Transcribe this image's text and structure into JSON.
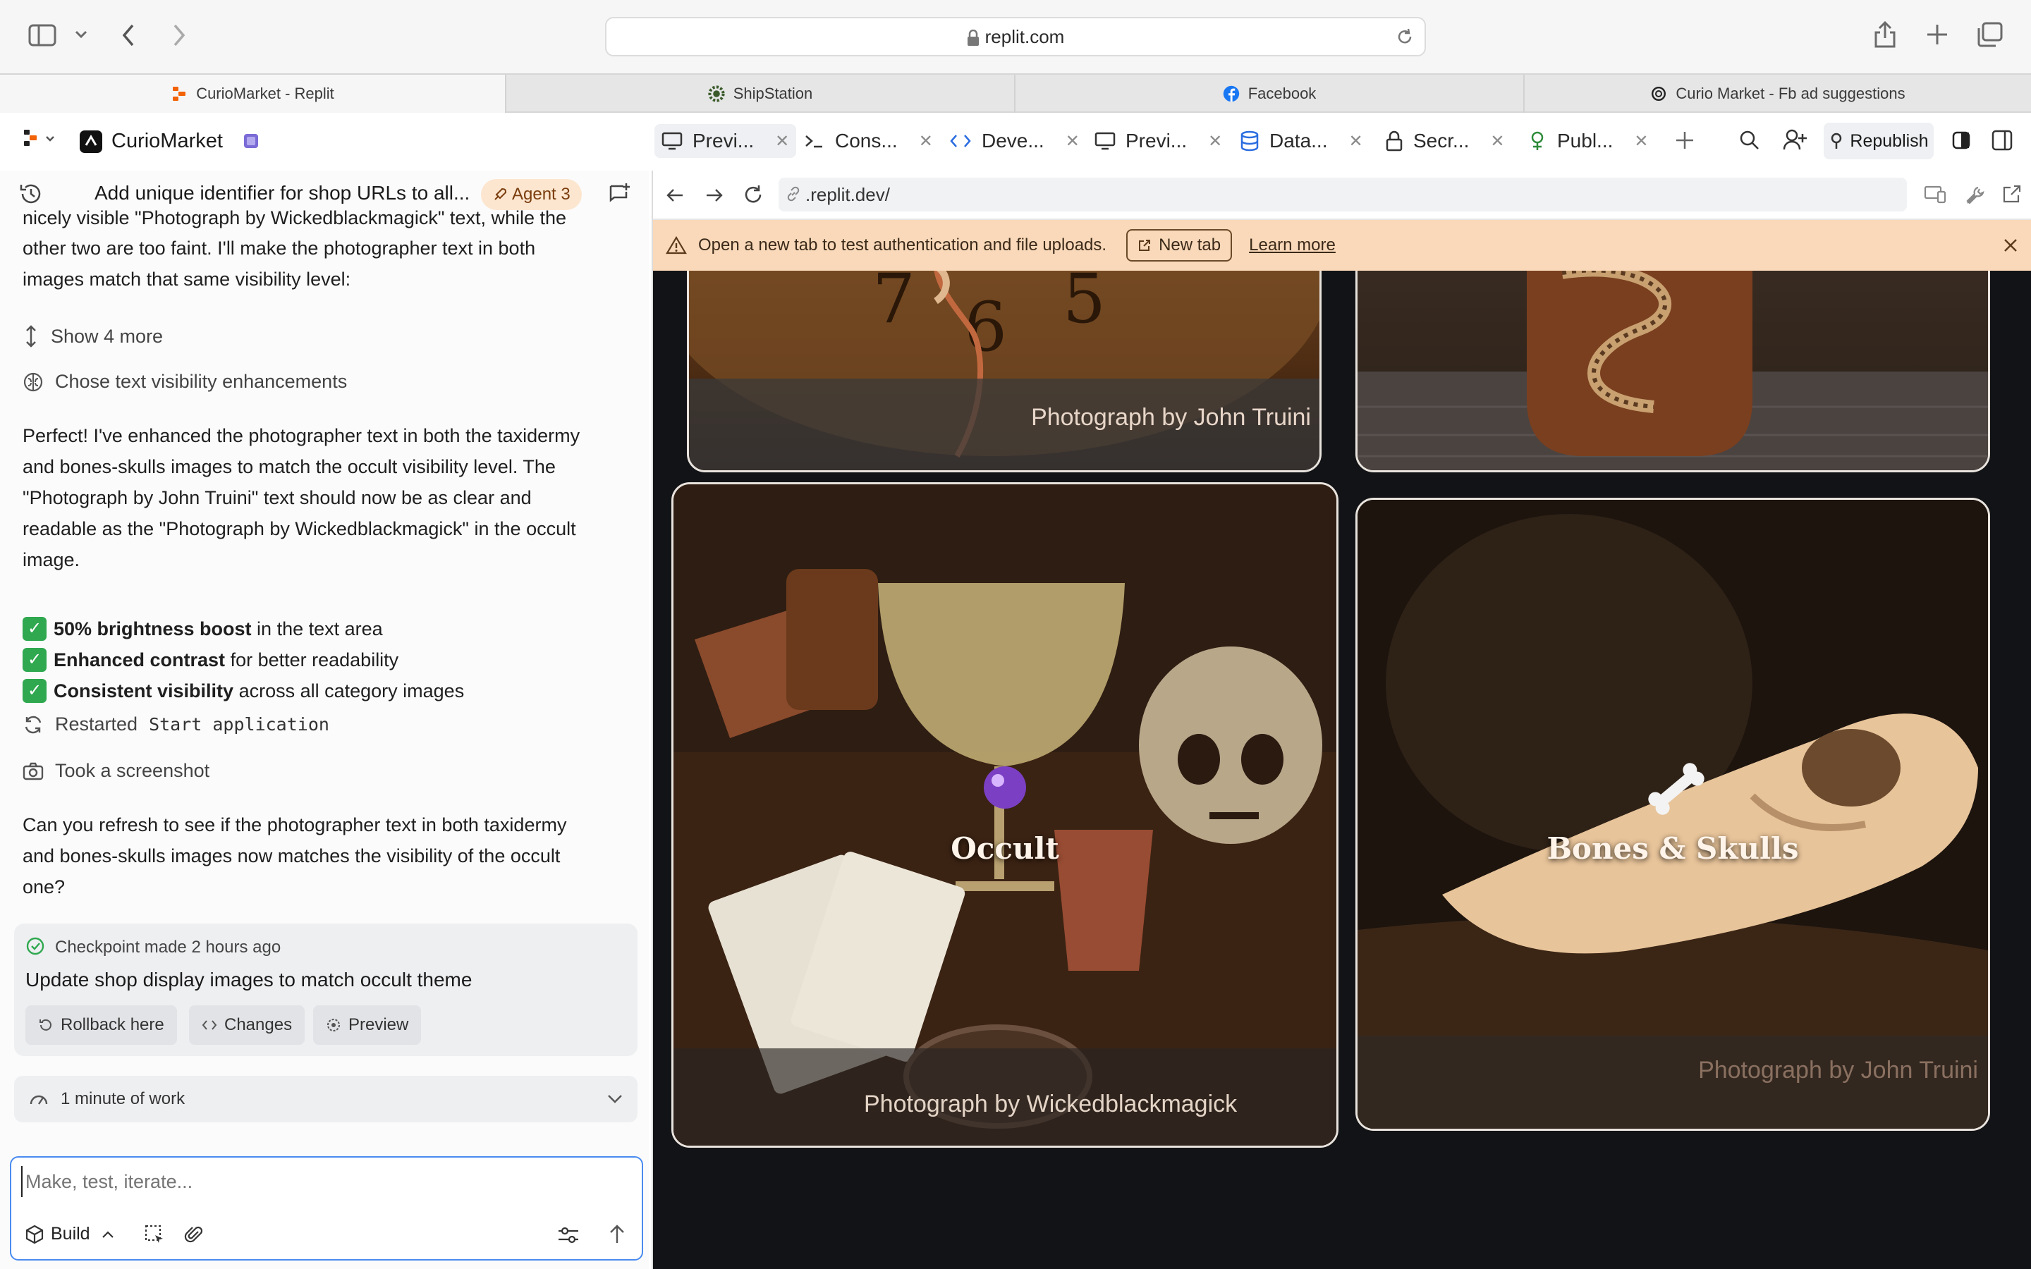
{
  "browser": {
    "url": "replit.com",
    "tabs": [
      {
        "label": "CurioMarket - Replit",
        "active": true
      },
      {
        "label": "ShipStation",
        "active": false
      },
      {
        "label": "Facebook",
        "active": false
      },
      {
        "label": "Curio Market - Fb ad suggestions",
        "active": false
      }
    ]
  },
  "app": {
    "project_name": "CurioMarket",
    "tabs": [
      {
        "label": "Previ...",
        "icon": "monitor-icon"
      },
      {
        "label": "Cons...",
        "icon": "terminal-icon"
      },
      {
        "label": "Deve...",
        "icon": "code-icon"
      },
      {
        "label": "Previ...",
        "icon": "monitor-icon"
      },
      {
        "label": "Data...",
        "icon": "database-icon"
      },
      {
        "label": "Secr...",
        "icon": "lock-icon"
      },
      {
        "label": "Publ...",
        "icon": "publish-icon"
      }
    ],
    "republish_label": "Republish"
  },
  "chat": {
    "thread_title": "Add unique identifier for shop URLs to all...",
    "agent_badge": "Agent 3",
    "partial_para": {
      "line1": "nicely visible \"Photograph by Wickedblackmagick\" text, while the",
      "line2": "other two are too faint. I'll make the photographer text in both",
      "line3": "images match that same visibility level:"
    },
    "show_more": "Show 4 more",
    "chose_text": "Chose text visibility enhancements",
    "perfect_para": {
      "line1": "Perfect! I've enhanced the photographer text in both the taxidermy",
      "line2": "and bones-skulls images to match the occult visibility level. The",
      "line3": "\"Photograph by John Truini\" text should now be as clear and",
      "line4": "readable as the \"Photograph by Wickedblackmagick\" in the occult",
      "line5": "image."
    },
    "bullets": [
      {
        "bold": "50% brightness boost",
        "rest": " in the text area"
      },
      {
        "bold": "Enhanced contrast",
        "rest": " for better readability"
      },
      {
        "bold": "Consistent visibility",
        "rest": " across all category images"
      }
    ],
    "restarted_prefix": "Restarted",
    "restarted_code": "Start application",
    "screenshot_text": "Took a screenshot",
    "question_para": {
      "line1": "Can you refresh to see if the photographer text in both taxidermy",
      "line2": "and bones-skulls images now matches the visibility of the occult",
      "line3": "one?"
    },
    "checkpoint": {
      "status": "Checkpoint made 2 hours ago",
      "title": "Update shop display images to match occult theme",
      "rollback": "Rollback here",
      "changes": "Changes",
      "preview": "Preview"
    },
    "work_time": "1 minute of work",
    "composer": {
      "placeholder": "Make, test, iterate...",
      "mode": "Build"
    }
  },
  "preview": {
    "url": ".replit.dev/",
    "banner_text": "Open a new tab to test authentication and file uploads.",
    "new_tab": "New tab",
    "learn_more": "Learn more",
    "cards": {
      "taxidermy_credit": "Photograph by John Truini",
      "occult_title": "Occult",
      "occult_credit": "Photograph by Wickedblackmagick",
      "bones_title": "Bones & Skulls",
      "bones_credit": "Photograph by John Truini"
    }
  },
  "colors": {
    "accent_blue": "#4a8bf0",
    "banner_bg": "#f9d9b9",
    "agent_badge_bg": "#fde6cf",
    "check_green": "#2fa84f"
  }
}
